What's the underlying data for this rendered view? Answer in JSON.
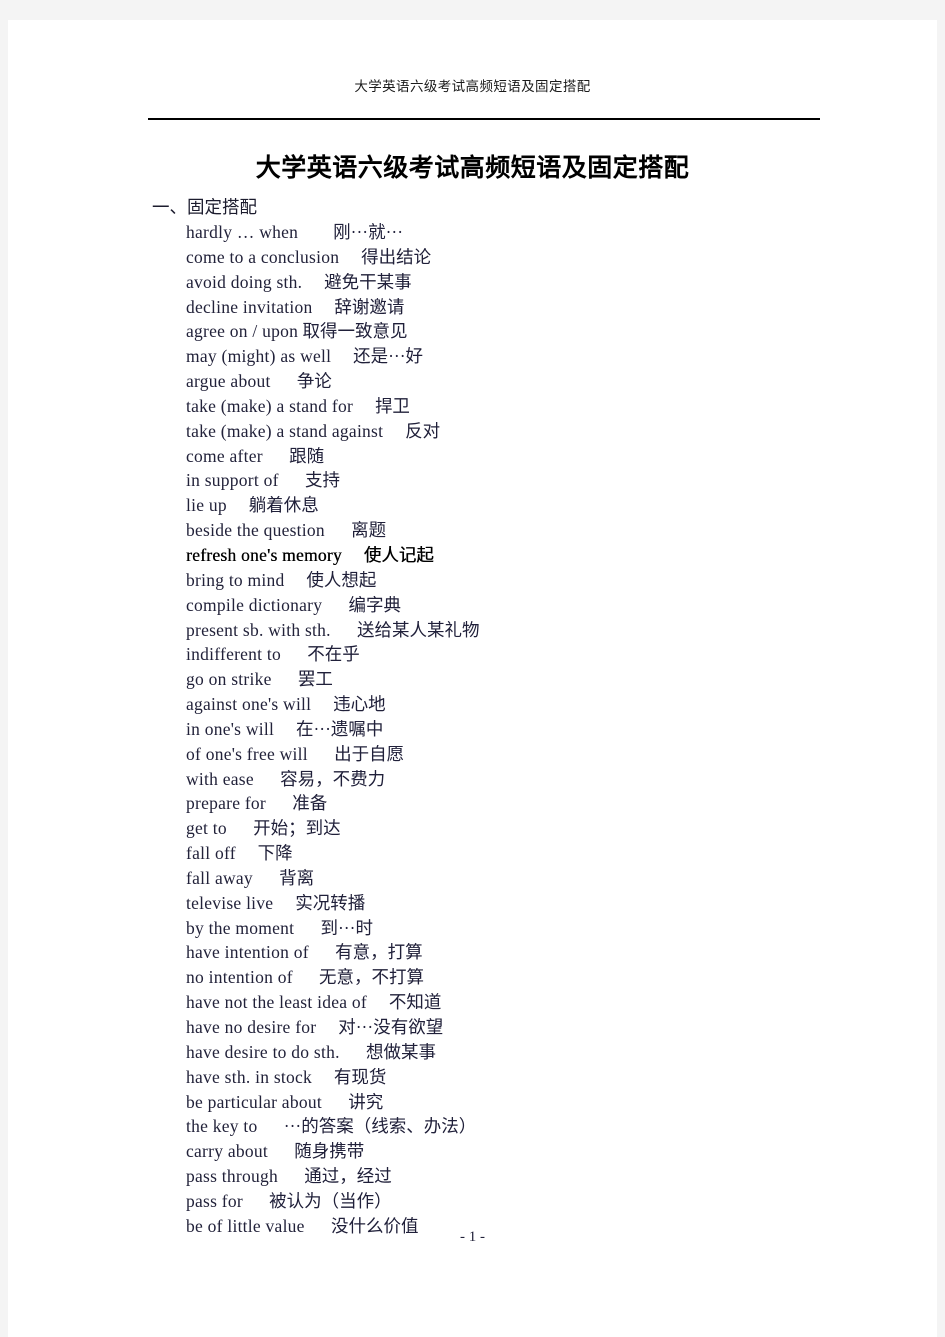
{
  "header": {
    "running_title": "大学英语六级考试高频短语及固定搭配"
  },
  "title": "大学英语六级考试高频短语及固定搭配",
  "section": {
    "heading": "一、固定搭配"
  },
  "entries": [
    {
      "en": "hardly … when",
      "gap": "        ",
      "zh": "刚···就···"
    },
    {
      "en": "come to a conclusion",
      "gap": "     ",
      "zh": "得出结论"
    },
    {
      "en": "avoid doing sth.",
      "gap": "     ",
      "zh": "避免干某事"
    },
    {
      "en": "decline invitation",
      "gap": "     ",
      "zh": "辞谢邀请"
    },
    {
      "en": "agree on / upon",
      "gap": " ",
      "zh": "取得一致意见"
    },
    {
      "en": "may (might) as well",
      "gap": "     ",
      "zh": "还是···好"
    },
    {
      "en": "argue about",
      "gap": "      ",
      "zh": "争论"
    },
    {
      "en": "take (make) a stand for",
      "gap": "     ",
      "zh": "捍卫"
    },
    {
      "en": "take (make) a stand against",
      "gap": "     ",
      "zh": "反对"
    },
    {
      "en": "come after",
      "gap": "      ",
      "zh": "跟随"
    },
    {
      "en": "in support of",
      "gap": "      ",
      "zh": "支持"
    },
    {
      "en": "lie up",
      "gap": "     ",
      "zh": "躺着休息"
    },
    {
      "en": "beside the question",
      "gap": "      ",
      "zh": "离题"
    },
    {
      "en": "refresh one's memory",
      "gap": "     ",
      "zh": "使人记起",
      "heavy": true
    },
    {
      "en": "bring to mind",
      "gap": "     ",
      "zh": "使人想起"
    },
    {
      "en": "compile dictionary",
      "gap": "      ",
      "zh": "编字典"
    },
    {
      "en": "present sb. with sth.",
      "gap": "      ",
      "zh": "送给某人某礼物"
    },
    {
      "en": "indifferent to",
      "gap": "      ",
      "zh": "不在乎"
    },
    {
      "en": "go on strike",
      "gap": "      ",
      "zh": "罢工"
    },
    {
      "en": "against one's will",
      "gap": "     ",
      "zh": "违心地"
    },
    {
      "en": "in one's will",
      "gap": "     ",
      "zh": "在···遗嘱中"
    },
    {
      "en": "of one's free will",
      "gap": "      ",
      "zh": "出于自愿"
    },
    {
      "en": "with ease",
      "gap": "      ",
      "zh": "容易，不费力"
    },
    {
      "en": "prepare for",
      "gap": "      ",
      "zh": "准备"
    },
    {
      "en": "get to",
      "gap": "      ",
      "zh": "开始；到达"
    },
    {
      "en": "fall off",
      "gap": "     ",
      "zh": "下降"
    },
    {
      "en": "fall away",
      "gap": "      ",
      "zh": "背离"
    },
    {
      "en": "televise live",
      "gap": "     ",
      "zh": "实况转播"
    },
    {
      "en": "by the moment",
      "gap": "      ",
      "zh": "到···时"
    },
    {
      "en": "have intention of",
      "gap": "      ",
      "zh": "有意，打算"
    },
    {
      "en": "no intention of",
      "gap": "      ",
      "zh": "无意，不打算"
    },
    {
      "en": "have not the least idea of",
      "gap": "     ",
      "zh": "不知道"
    },
    {
      "en": "have no desire for",
      "gap": "     ",
      "zh": "对···没有欲望"
    },
    {
      "en": "have desire to do sth.",
      "gap": "      ",
      "zh": "想做某事"
    },
    {
      "en": "have sth. in stock",
      "gap": "     ",
      "zh": "有现货"
    },
    {
      "en": "be particular about",
      "gap": "      ",
      "zh": "讲究"
    },
    {
      "en": "the key to",
      "gap": "      ",
      "zh": "···的答案（线索、办法）"
    },
    {
      "en": "carry about",
      "gap": "      ",
      "zh": "随身携带"
    },
    {
      "en": "pass through",
      "gap": "      ",
      "zh": "通过，经过"
    },
    {
      "en": "pass for",
      "gap": "      ",
      "zh": "被认为（当作）"
    },
    {
      "en": "be of little value",
      "gap": "      ",
      "zh": "没什么价值"
    }
  ],
  "footer": {
    "page_number": "- 1 -"
  }
}
